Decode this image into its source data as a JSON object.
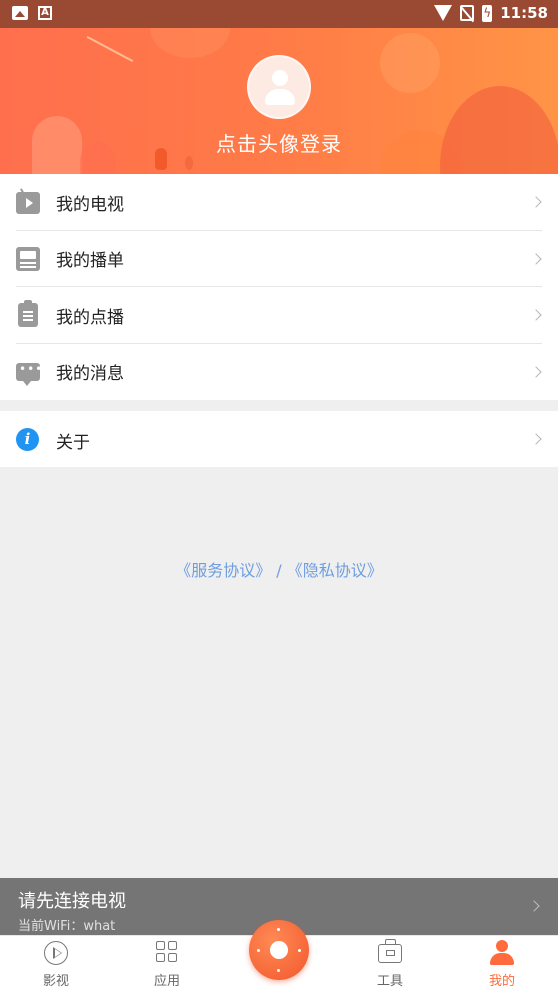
{
  "status_bar": {
    "time": "11:58",
    "left_icons": [
      "image-notification-icon",
      "a-notification-icon"
    ],
    "right_icons": [
      "wifi-icon",
      "no-sim-icon",
      "battery-charging-icon"
    ]
  },
  "header": {
    "login_prompt": "点击头像登录",
    "avatar_icon": "avatar-placeholder-icon"
  },
  "menu": {
    "items": [
      {
        "label": "我的电视",
        "icon": "tv-icon"
      },
      {
        "label": "我的播单",
        "icon": "playlist-icon"
      },
      {
        "label": "我的点播",
        "icon": "clipboard-icon"
      },
      {
        "label": "我的消息",
        "icon": "message-icon"
      }
    ],
    "about": {
      "label": "关于",
      "icon": "info-icon"
    }
  },
  "agreements": {
    "service": "《服务协议》",
    "separator": " / ",
    "privacy": "《隐私协议》"
  },
  "connect_bar": {
    "title": "请先连接电视",
    "wifi": "当前WiFi：what"
  },
  "bottom_nav": {
    "items": [
      {
        "label": "影视",
        "icon": "play-circle-icon"
      },
      {
        "label": "应用",
        "icon": "grid-icon"
      },
      {
        "label": "工具",
        "icon": "toolbox-icon"
      },
      {
        "label": "我的",
        "icon": "user-icon",
        "active": true
      }
    ],
    "center_icon": "remote-control-icon"
  },
  "colors": {
    "accent": "#ff6b3d",
    "header_gradient": [
      "#ff6f4e",
      "#ff9446"
    ],
    "link": "#6e9ee0",
    "connect_bar_bg": "#757575"
  }
}
